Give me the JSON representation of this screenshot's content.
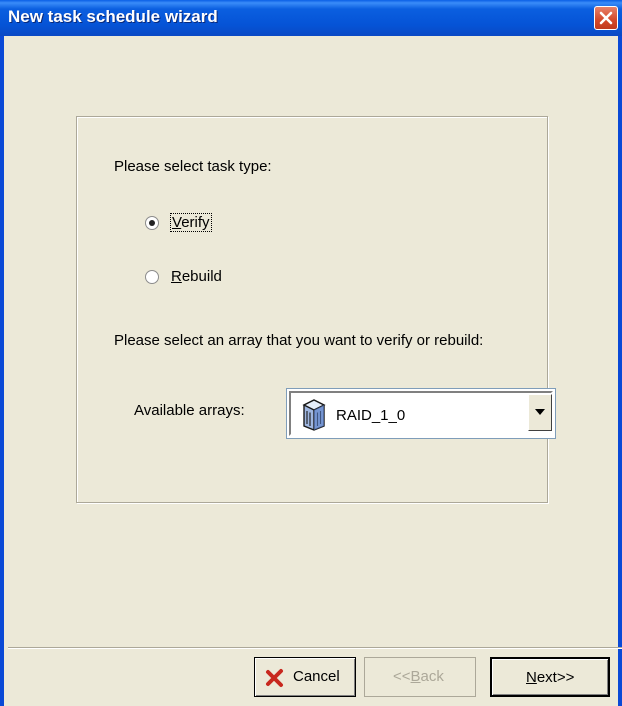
{
  "window": {
    "title": "New task schedule wizard",
    "close_icon": "close-icon"
  },
  "task_type": {
    "prompt": "Please select task type:",
    "options": [
      {
        "label": "Verify",
        "mnemonic": "V",
        "rest": "erify",
        "selected": true
      },
      {
        "label": "Rebuild",
        "mnemonic": "R",
        "rest": "ebuild",
        "selected": false
      }
    ]
  },
  "array_select": {
    "prompt": "Please select an array that you want to verify or rebuild:",
    "label": "Available arrays:",
    "selected_value": "RAID_1_0",
    "icon": "disk-array-icon"
  },
  "buttons": {
    "cancel": {
      "label": "Cancel",
      "icon": "red-x-icon"
    },
    "back": {
      "prefix": "<<",
      "mnemonic": "B",
      "rest": "ack",
      "label": "<<Back",
      "enabled": false
    },
    "next": {
      "mnemonic": "N",
      "rest": "ext>>",
      "label": "Next>>"
    }
  },
  "colors": {
    "titlebar": "#0553D6",
    "window_bg": "#ECE9D8",
    "close_button": "#D4482A",
    "cancel_icon": "#C8281E"
  }
}
